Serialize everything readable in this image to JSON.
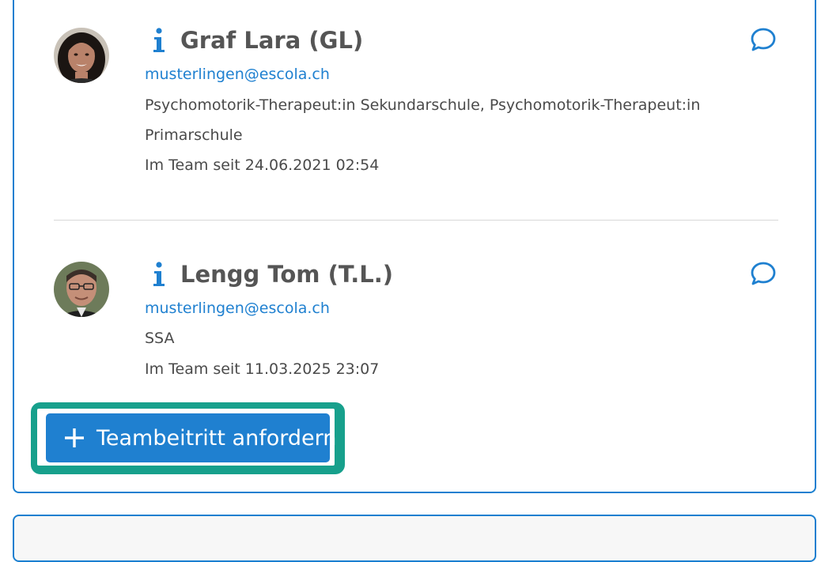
{
  "members": [
    {
      "name": "Graf Lara (GL)",
      "email": "musterlingen@escola.ch",
      "role_line1": "Psychomotorik-Therapeut:in Sekundarschule, Psychomotorik-Therapeut:in",
      "role_line2": "Primarschule",
      "since": "Im Team seit 24.06.2021 02:54"
    },
    {
      "name": "Lengg Tom (T.L.)",
      "email": "musterlingen@escola.ch",
      "role_line1": "SSA",
      "since": "Im Team seit 11.03.2025 23:07"
    }
  ],
  "actions": {
    "request_join_label": "Teambeitritt anfordern"
  },
  "icons": {
    "info": "info-icon",
    "chat": "chat-bubble-icon",
    "plus": "plus-icon"
  },
  "colors": {
    "accent": "#1f80d0",
    "highlight": "#17a08c",
    "name_text": "#555555",
    "body_text": "#4a4a4a",
    "divider": "#d8d8d8"
  }
}
